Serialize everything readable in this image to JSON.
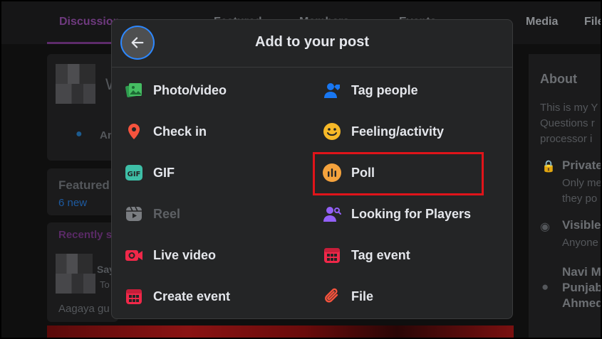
{
  "background": {
    "tabs": [
      {
        "label": "Discussion",
        "active": true
      },
      {
        "label": "Featured"
      },
      {
        "label": "Members"
      },
      {
        "label": "Events"
      },
      {
        "label": "Media"
      },
      {
        "label": "Files"
      }
    ],
    "left": {
      "post_box_letter": "W",
      "anonymous_label": "An",
      "featured": {
        "title": "Featured",
        "new_count": "6 new"
      },
      "recently_label": "Recently s",
      "post_author": "Say",
      "post_meta": "To",
      "post_text": "Aagaya gu"
    },
    "right": {
      "about_title": "About",
      "about_lines": [
        "This is my Y",
        "Questions r",
        "processor i"
      ],
      "privacy_title": "Private",
      "privacy_lines": [
        "Only me",
        "they po"
      ],
      "visible_title": "Visible",
      "visible_line": "Anyone",
      "location_lines": [
        "Navi M",
        "Punjab",
        "Ahmed"
      ]
    }
  },
  "modal": {
    "title": "Add to your post",
    "back_label": "Back",
    "options_left": [
      {
        "label": "Photo/video",
        "icon": "photo-icon",
        "color": "#45bd62"
      },
      {
        "label": "Check in",
        "icon": "location-pin-icon",
        "color": "#f5533d"
      },
      {
        "label": "GIF",
        "icon": "gif-icon",
        "color": "#3ebfa7"
      },
      {
        "label": "Reel",
        "icon": "reel-icon",
        "color": "#7a7d81",
        "disabled": true
      },
      {
        "label": "Live video",
        "icon": "live-video-icon",
        "color": "#f02849"
      },
      {
        "label": "Create event",
        "icon": "calendar-icon",
        "color": "#f02849"
      }
    ],
    "options_right": [
      {
        "label": "Tag people",
        "icon": "tag-people-icon",
        "color": "#1877f2"
      },
      {
        "label": "Feeling/activity",
        "icon": "smiley-icon",
        "color": "#f7b928"
      },
      {
        "label": "Poll",
        "icon": "poll-icon",
        "color": "#f5a33d",
        "highlighted": true
      },
      {
        "label": "Looking for Players",
        "icon": "player-search-icon",
        "color": "#9360f7"
      },
      {
        "label": "Tag event",
        "icon": "calendar-icon",
        "color": "#f02849"
      },
      {
        "label": "File",
        "icon": "paperclip-icon",
        "color": "#f5533d"
      }
    ]
  },
  "colors": {
    "modal_bg": "#242526",
    "highlight": "#e0141a",
    "focus_ring": "#2d88ff"
  }
}
